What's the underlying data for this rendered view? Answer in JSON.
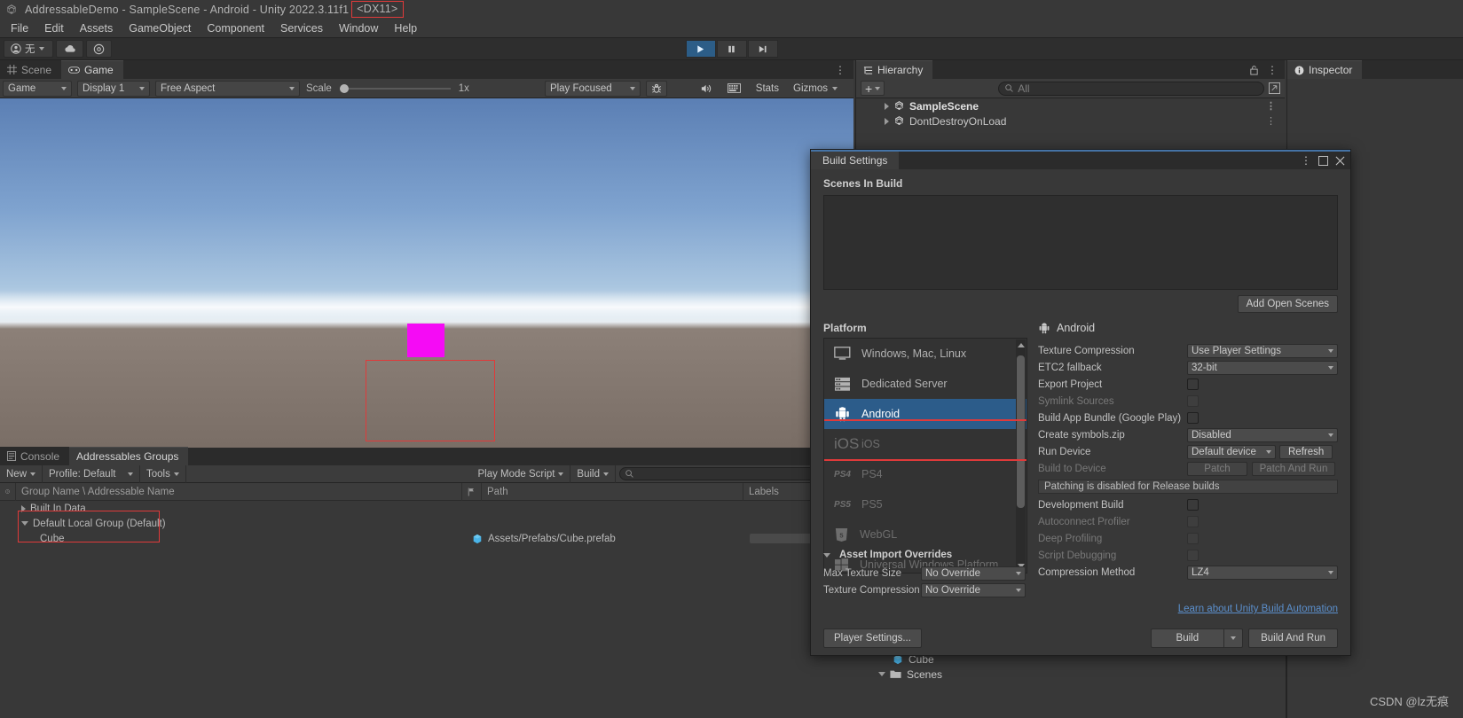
{
  "window": {
    "title": "AddressableDemo - SampleScene - Android - Unity 2022.3.11f1",
    "graphics_api": "<DX11>"
  },
  "menu": {
    "items": [
      "File",
      "Edit",
      "Assets",
      "GameObject",
      "Component",
      "Services",
      "Window",
      "Help"
    ]
  },
  "toolbar": {
    "account_label": "无",
    "cloud_icon": "cloud-icon",
    "settings_icon": "gear-icon",
    "play_icon": "play-icon",
    "pause_icon": "pause-icon",
    "step_icon": "step-icon"
  },
  "game_panel": {
    "tabs": [
      {
        "label": "Scene",
        "icon": "grid-icon",
        "active": false
      },
      {
        "label": "Game",
        "icon": "gamepad-icon",
        "active": true
      }
    ],
    "toolbar": {
      "display_target": "Game",
      "display": "Display 1",
      "aspect": "Free Aspect",
      "scale_label": "Scale",
      "scale_value": "1x",
      "play_mode": "Play Focused",
      "bug_icon": "bug-icon",
      "mute_icon": "audio-icon",
      "grid_icon": "grid-icon",
      "stats_label": "Stats",
      "gizmos_label": "Gizmos"
    }
  },
  "addressables": {
    "tabs": [
      {
        "label": "Console",
        "icon": "console-icon",
        "active": false
      },
      {
        "label": "Addressables Groups",
        "icon": "",
        "active": true
      }
    ],
    "toolbar": {
      "new_label": "New",
      "profile_label": "Profile: Default",
      "tools_label": "Tools",
      "play_mode_script": "Play Mode Script",
      "build_label": "Build",
      "search_placeholder": ""
    },
    "columns": [
      "Group Name \\ Addressable Name",
      "Path",
      "Labels"
    ],
    "rows": [
      {
        "name": "Built In Data",
        "path": "",
        "labels": "",
        "expanded": false,
        "indent": 1,
        "is_group": true
      },
      {
        "name": "Default Local Group (Default)",
        "path": "",
        "labels": "",
        "expanded": true,
        "indent": 1,
        "is_group": true
      },
      {
        "name": "Cube",
        "path": "Assets/Prefabs/Cube.prefab",
        "labels": "",
        "expanded": false,
        "indent": 2,
        "is_group": false
      }
    ]
  },
  "hierarchy": {
    "tab_label": "Hierarchy",
    "search_placeholder": "All",
    "create_label": "+",
    "items": [
      {
        "label": "SampleScene",
        "bold": true
      },
      {
        "label": "DontDestroyOnLoad",
        "bold": false
      }
    ]
  },
  "inspector": {
    "tab_label": "Inspector"
  },
  "project_strip": {
    "items": [
      {
        "label": "Cube",
        "icon": "prefab-icon",
        "indent": 2
      },
      {
        "label": "Scenes",
        "icon": "folder-icon",
        "indent": 1
      }
    ]
  },
  "build_settings": {
    "title": "Build Settings",
    "scenes_in_build_label": "Scenes In Build",
    "add_open_scenes_label": "Add Open Scenes",
    "platform_label": "Platform",
    "platforms": [
      {
        "label": "Windows, Mac, Linux",
        "icon": "monitor-icon",
        "state": "normal"
      },
      {
        "label": "Dedicated Server",
        "icon": "server-icon",
        "state": "normal"
      },
      {
        "label": "Android",
        "icon": "android-icon",
        "state": "selected"
      },
      {
        "label": "iOS",
        "icon": "ios-icon",
        "state": "dimmed"
      },
      {
        "label": "PS4",
        "icon": "ps4-icon",
        "state": "dimmed"
      },
      {
        "label": "PS5",
        "icon": "ps5-icon",
        "state": "dimmed"
      },
      {
        "label": "WebGL",
        "icon": "html5-icon",
        "state": "dimmed"
      },
      {
        "label": "Universal Windows Platform",
        "icon": "windows-icon",
        "state": "dimmed"
      }
    ],
    "target_title": "Android",
    "settings": [
      {
        "label": "Texture Compression",
        "type": "dropdown",
        "value": "Use Player Settings",
        "dim": false
      },
      {
        "label": "ETC2 fallback",
        "type": "dropdown",
        "value": "32-bit",
        "dim": false
      },
      {
        "label": "Export Project",
        "type": "checkbox",
        "value": false,
        "dim": false
      },
      {
        "label": "Symlink Sources",
        "type": "checkbox",
        "value": false,
        "dim": true
      },
      {
        "label": "Build App Bundle (Google Play)",
        "type": "checkbox",
        "value": false,
        "dim": false
      },
      {
        "label": "Create symbols.zip",
        "type": "dropdown",
        "value": "Disabled",
        "dim": false
      }
    ],
    "run_device": {
      "label": "Run Device",
      "value": "Default device",
      "refresh_label": "Refresh"
    },
    "build_to_device": {
      "label": "Build to Device",
      "patch_label": "Patch",
      "patch_and_run_label": "Patch And Run"
    },
    "patch_note": "Patching is disabled for Release builds",
    "settings2": [
      {
        "label": "Development Build",
        "type": "checkbox",
        "value": false,
        "dim": false
      },
      {
        "label": "Autoconnect Profiler",
        "type": "checkbox",
        "value": false,
        "dim": true
      },
      {
        "label": "Deep Profiling",
        "type": "checkbox",
        "value": false,
        "dim": true
      },
      {
        "label": "Script Debugging",
        "type": "checkbox",
        "value": false,
        "dim": true
      }
    ],
    "compression_method": {
      "label": "Compression Method",
      "value": "LZ4"
    },
    "asset_import_overrides": {
      "title": "Asset Import Overrides",
      "rows": [
        {
          "label": "Max Texture Size",
          "value": "No Override"
        },
        {
          "label": "Texture Compression",
          "value": "No Override"
        }
      ]
    },
    "learn_link": "Learn about Unity Build Automation",
    "player_settings_label": "Player Settings...",
    "build_label": "Build",
    "build_and_run_label": "Build And Run"
  },
  "watermark": "CSDN @lz无痕"
}
